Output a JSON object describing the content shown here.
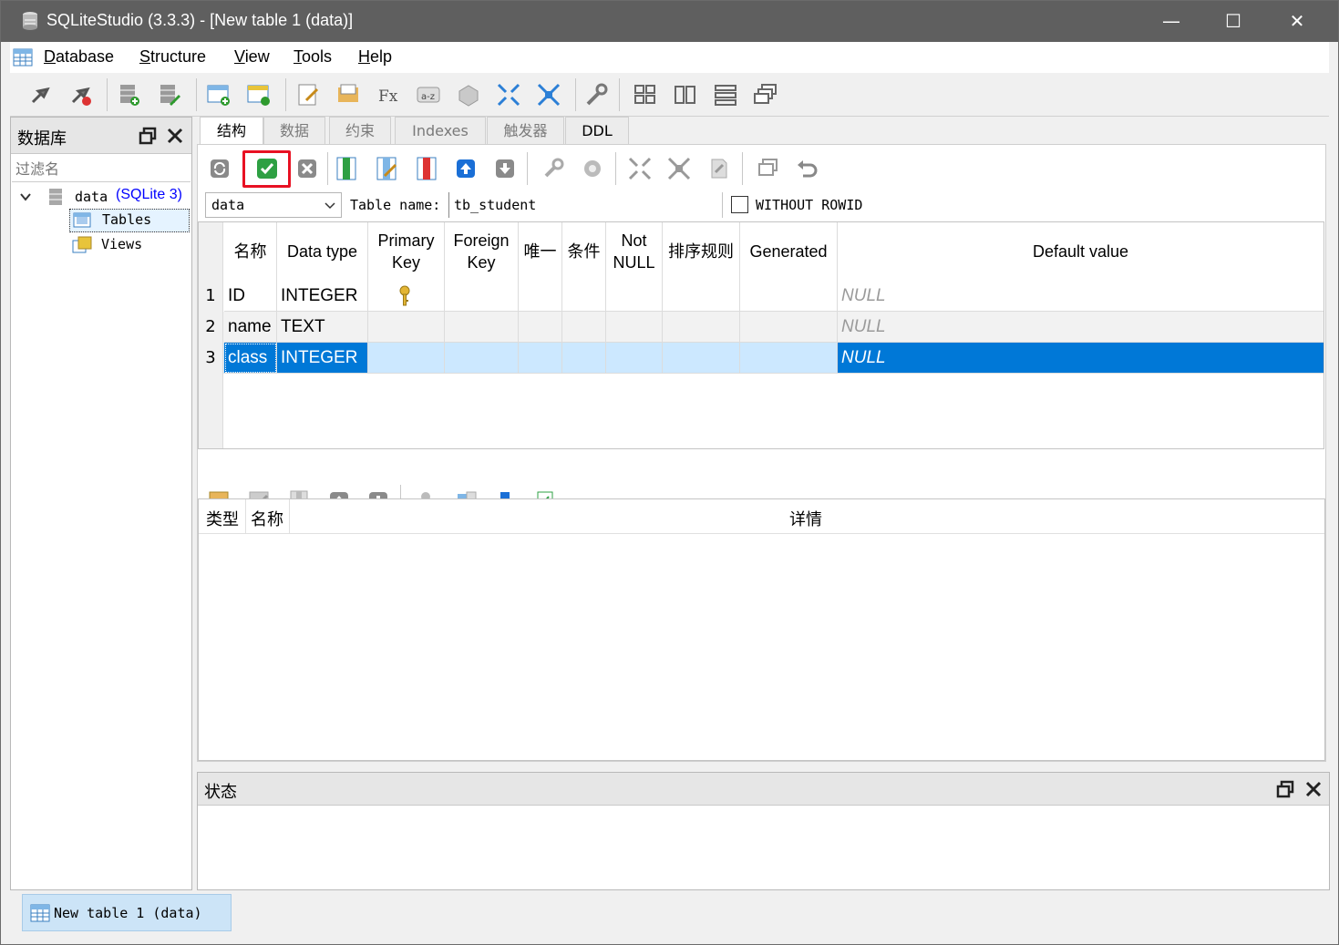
{
  "window": {
    "title": "SQLiteStudio (3.3.3) - [New table 1 (data)]",
    "minimize": "—",
    "maximize": "☐",
    "close": "✕"
  },
  "menu": [
    "Database",
    "Structure",
    "View",
    "Tools",
    "Help"
  ],
  "db_panel": {
    "title": "数据库",
    "filter_placeholder": "过滤名",
    "db_name": "data",
    "db_type": "(SQLite 3)",
    "items": [
      "Tables",
      "Views"
    ]
  },
  "tabs": [
    "结构",
    "数据",
    "约束",
    "Indexes",
    "触发器",
    "DDL"
  ],
  "table_editor": {
    "db_select": "data",
    "table_name_label": "Table name:",
    "table_name_value": "tb_student",
    "without_rowid_label": "WITHOUT ROWID",
    "without_rowid_checked": false
  },
  "columns_grid": {
    "headers": [
      "名称",
      "Data type",
      "Primary Key",
      "Foreign Key",
      "唯一",
      "条件",
      "Not NULL",
      "排序规则",
      "Generated",
      "Default value"
    ],
    "rows": [
      {
        "num": "1",
        "name": "ID",
        "type": "INTEGER",
        "primary_key": true,
        "default": "NULL"
      },
      {
        "num": "2",
        "name": "name",
        "type": "TEXT",
        "primary_key": false,
        "default": "NULL"
      },
      {
        "num": "3",
        "name": "class",
        "type": "INTEGER",
        "primary_key": false,
        "default": "NULL"
      }
    ],
    "selected_row": 3
  },
  "constraints_grid": {
    "headers": [
      "类型",
      "名称",
      "详情"
    ]
  },
  "status_panel": {
    "title": "状态"
  },
  "taskbar": {
    "item": "New table 1 (data)"
  },
  "colors": {
    "titlebar": "#5f5f5f",
    "selection": "#0078d7",
    "selection_light": "#cce8ff",
    "highlight_box": "#e81123",
    "accent_link": "#0000ff"
  }
}
